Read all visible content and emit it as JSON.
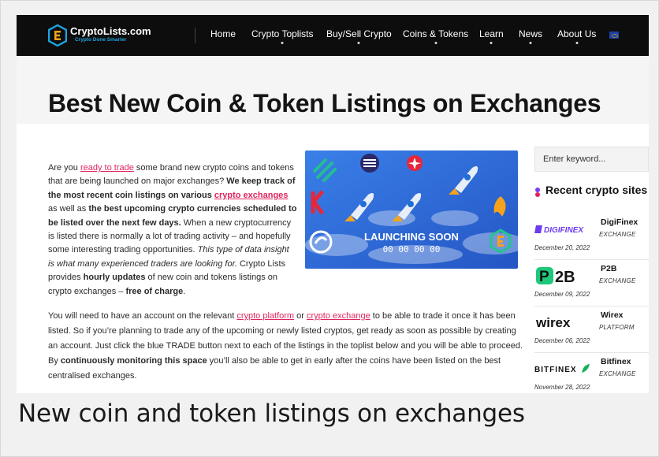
{
  "logo": {
    "name": "CryptoLists.com",
    "tagline": "Crypto Done Smarter"
  },
  "nav": {
    "items": [
      {
        "label": "Home",
        "has_dropdown": false
      },
      {
        "label": "Crypto Toplists",
        "has_dropdown": true
      },
      {
        "label": "Buy/Sell Crypto",
        "has_dropdown": true
      },
      {
        "label": "Coins & Tokens",
        "has_dropdown": true
      },
      {
        "label": "Learn",
        "has_dropdown": true
      },
      {
        "label": "News",
        "has_dropdown": true
      },
      {
        "label": "About Us",
        "has_dropdown": true
      }
    ],
    "language_flag": "eu-flag-icon"
  },
  "page": {
    "title": "Best New Coin & Token Listings on Exchanges"
  },
  "intro": {
    "t1": "Are you ",
    "l1": "ready to trade",
    "t2": " some brand new crypto coins and tokens that are being launched on major exchanges? ",
    "b1": "We keep track of the most recent coin listings on various ",
    "l2": "crypto exchanges",
    "t3": " as well as ",
    "b2": "the best upcoming crypto currencies scheduled to be listed over the next few days.",
    "t4": " When a new cryptocurrency is listed there is normally a lot of trading activity – and hopefully some interesting trading opportunities. ",
    "i1": "This type of data insight is what many experienced traders are looking for.",
    "t5": " Crypto Lists provides ",
    "b3": "hourly updates",
    "t6": " of new coin and tokens listings on crypto exchanges – ",
    "b4": "free of charge",
    "t7": "."
  },
  "banner": {
    "text": "LAUNCHING SOON",
    "countdown": "00 00 00 00"
  },
  "body2": {
    "t1": "You will need to have an account on the relevant ",
    "l1": "crypto platform",
    "t2": " or ",
    "l2": "crypto exchange",
    "t3": " to be able to trade it once it has been listed. So if you’re planning to trade any of the upcoming or newly listed cryptos, get ready as soon as possible by creating an account. Just click the blue TRADE button next to each of the listings in the toplist below and you will be able to proceed. By ",
    "b1": "continuously monitoring this space",
    "t4": " you’ll also be able to get in early after the coins have been listed on the best centralised exchanges."
  },
  "sidebar": {
    "search_placeholder": "Enter keyword...",
    "title": "Recent crypto sites",
    "sites": [
      {
        "logo_text": "DIGIFINEX",
        "name": "DigiFinex",
        "type": "EXCHANGE",
        "date": "December 20, 2022"
      },
      {
        "logo_text": "P2B",
        "name": "P2B",
        "type": "EXCHANGE",
        "date": "December 09, 2022"
      },
      {
        "logo_text": "wirex",
        "name": "Wirex",
        "type": "PLATFORM",
        "date": "December 06, 2022"
      },
      {
        "logo_text": "BITFINEX",
        "name": "Bitfinex",
        "type": "EXCHANGE",
        "date": "November 28, 2022"
      }
    ]
  },
  "caption": "New coin and token listings on exchanges",
  "colors": {
    "link": "#e0245e",
    "nav_bg": "#0d0d0d",
    "accent_blue": "#1fa3e0"
  }
}
